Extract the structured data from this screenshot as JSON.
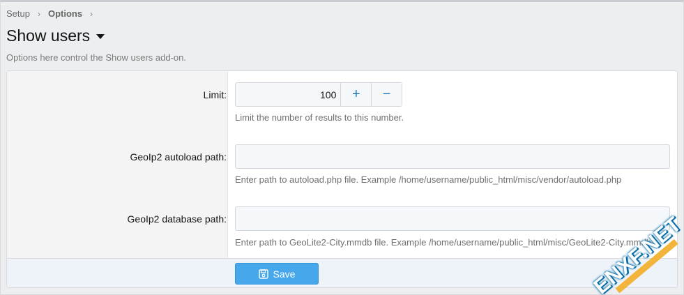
{
  "breadcrumb": {
    "items": [
      "Setup",
      "Options"
    ],
    "separator": "›"
  },
  "header": {
    "title": "Show users",
    "description": "Options here control the Show users add-on."
  },
  "form": {
    "limit": {
      "label": "Limit:",
      "value": "100",
      "increment_label": "+",
      "decrement_label": "−",
      "hint": "Limit the number of results to this number."
    },
    "autoload": {
      "label": "GeoIp2 autoload path:",
      "value": "",
      "hint": "Enter path to autoload.php file. Example /home/username/public_html/misc/vendor/autoload.php"
    },
    "database": {
      "label": "GeoIp2 database path:",
      "value": "",
      "hint": "Enter path to GeoLite2-City.mmdb file. Example /home/username/public_html/misc/GeoLite2-City.mmdb"
    }
  },
  "footer": {
    "save_label": "Save"
  },
  "watermark": {
    "text": "ENXF.NET"
  },
  "colors": {
    "accent": "#47a7eb",
    "link": "#2577b1",
    "footer_bg": "#edf3f9"
  }
}
